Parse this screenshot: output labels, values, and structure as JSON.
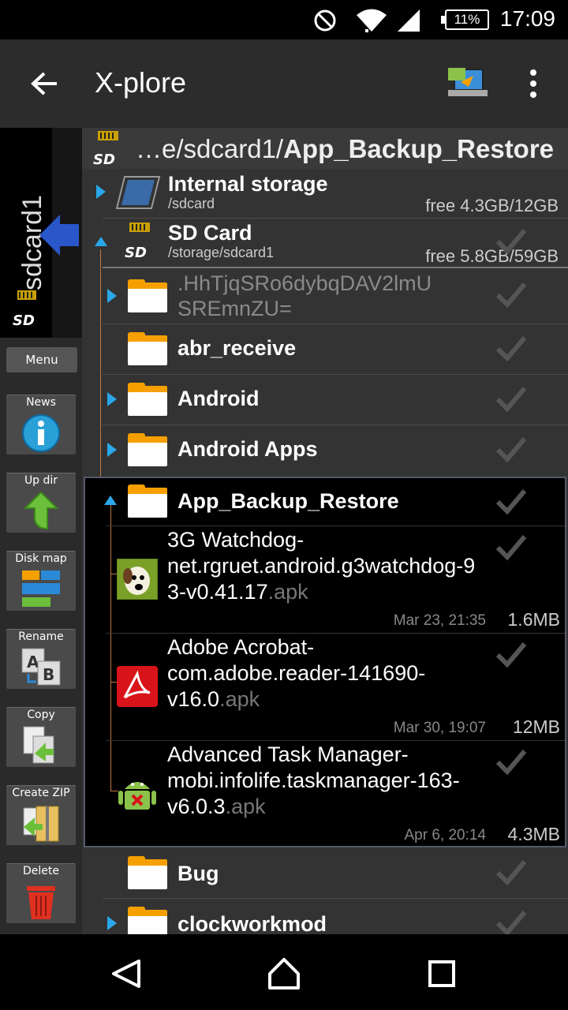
{
  "status": {
    "battery": "11%",
    "time": "17:09"
  },
  "app": {
    "title": "X-plore"
  },
  "left": {
    "volume_label": "sdcard1",
    "menu_label": "Menu",
    "tools": [
      {
        "label": "News",
        "icon": "info-icon"
      },
      {
        "label": "Up dir",
        "icon": "up-arrow-icon"
      },
      {
        "label": "Disk map",
        "icon": "disk-map-icon"
      },
      {
        "label": "Rename",
        "icon": "rename-icon"
      },
      {
        "label": "Copy",
        "icon": "copy-icon"
      },
      {
        "label": "Create ZIP",
        "icon": "zip-icon"
      },
      {
        "label": "Delete",
        "icon": "trash-icon"
      }
    ]
  },
  "path": {
    "prefix": "…e/sdcard1/",
    "current": "App_Backup_Restore"
  },
  "storage": [
    {
      "name": "Internal storage",
      "path": "/sdcard",
      "free": "free 4.3GB/12GB"
    },
    {
      "name": "SD Card",
      "path": "/storage/sdcard1",
      "free": "free 5.8GB/59GB"
    }
  ],
  "folders": [
    {
      "name": ".HhTjqSRo6dybqDAV2lmU",
      "name2": "SREmnZU="
    },
    {
      "name": "abr_receive"
    },
    {
      "name": "Android"
    },
    {
      "name": "Android Apps"
    },
    {
      "name": "App_Backup_Restore"
    }
  ],
  "files": [
    {
      "l1": "3G Watchdog-",
      "l2": "net.rgruet.android.g3watchdog-9",
      "l3": "3-v0.41.17",
      "ext": ".apk",
      "date": "Mar 23, 21:35",
      "size": "1.6MB"
    },
    {
      "l1": "Adobe Acrobat-",
      "l2": "com.adobe.reader-141690-",
      "l3": "v16.0",
      "ext": ".apk",
      "date": "Mar 30, 19:07",
      "size": "12MB"
    },
    {
      "l1": "Advanced Task Manager-",
      "l2": "mobi.infolife.taskmanager-163-",
      "l3": "v6.0.3",
      "ext": ".apk",
      "date": "Apr 6, 20:14",
      "size": "4.3MB"
    }
  ],
  "folders_after": [
    {
      "name": "Bug"
    },
    {
      "name": "clockworkmod"
    }
  ],
  "colors": {
    "accent": "#2aa7e8",
    "folder": "#f5a000",
    "action_bar": "#2c2c2c"
  }
}
